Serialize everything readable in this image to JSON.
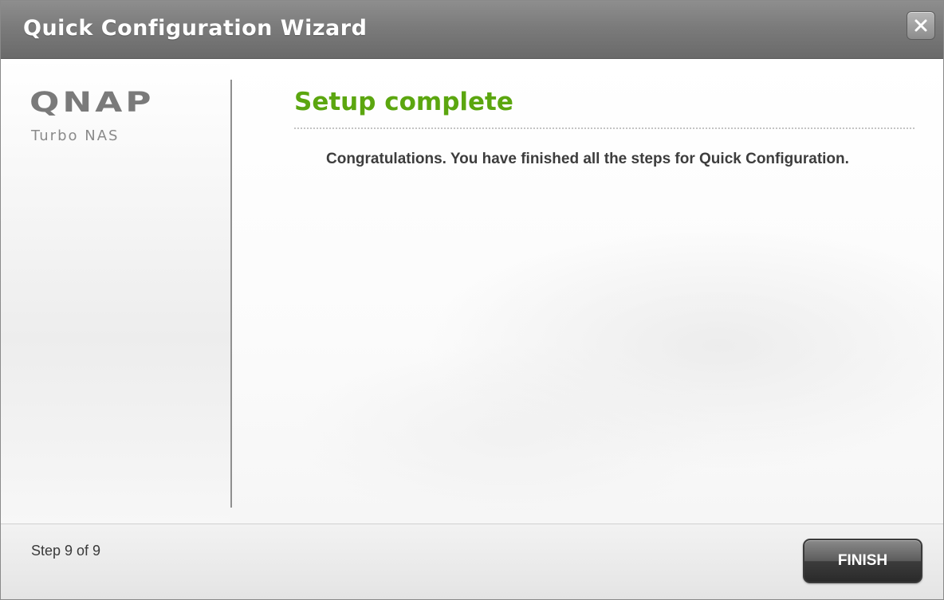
{
  "window": {
    "title": "Quick Configuration Wizard",
    "close_icon": "close-icon"
  },
  "sidebar": {
    "logo_text": "QNAP",
    "logo_subtitle": "Turbo NAS"
  },
  "main": {
    "heading": "Setup complete",
    "message": "Congratulations. You have finished all the steps for Quick Configuration."
  },
  "footer": {
    "step_text": "Step 9 of 9",
    "finish_label": "FINISH"
  },
  "colors": {
    "heading_green": "#5ba60f",
    "titlebar_gray": "#7b7b7b",
    "button_dark": "#3c3c3c"
  }
}
